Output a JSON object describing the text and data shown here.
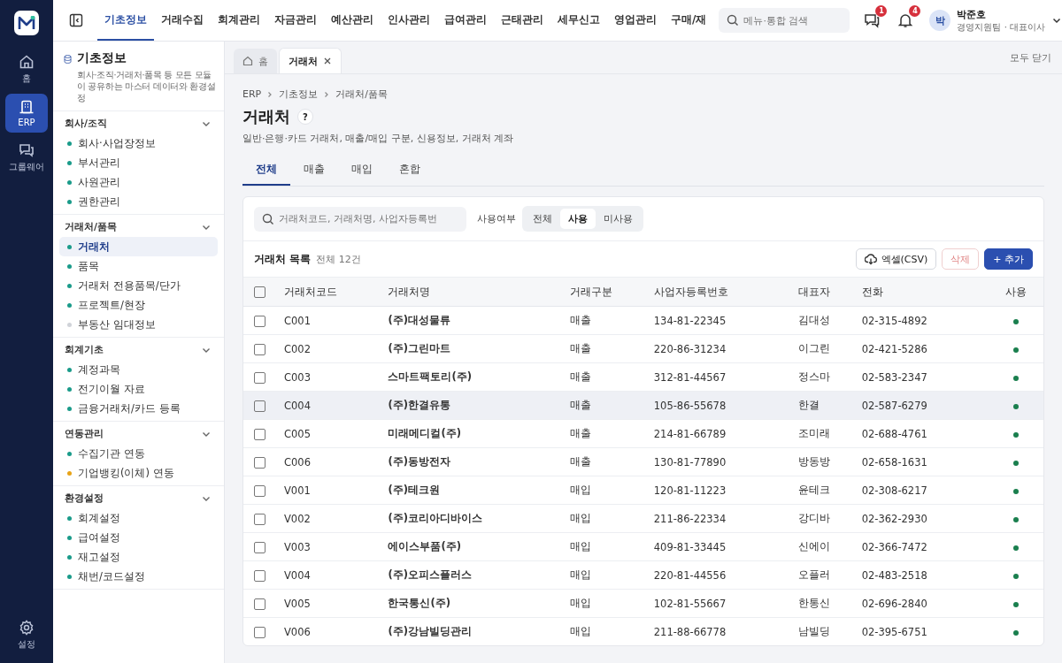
{
  "rail": {
    "items": [
      {
        "label": "홈",
        "selected": false
      },
      {
        "label": "ERP",
        "selected": true
      },
      {
        "label": "그룹웨어",
        "selected": false
      }
    ],
    "settings": "설정"
  },
  "top_nav": {
    "tabs": [
      {
        "label": "기초정보",
        "selected": true
      },
      {
        "label": "거래수집",
        "selected": false
      },
      {
        "label": "회계관리",
        "selected": false
      },
      {
        "label": "자금관리",
        "selected": false
      },
      {
        "label": "예산관리",
        "selected": false
      },
      {
        "label": "인사관리",
        "selected": false
      },
      {
        "label": "급여관리",
        "selected": false
      },
      {
        "label": "근태관리",
        "selected": false
      },
      {
        "label": "세무신고",
        "selected": false
      },
      {
        "label": "영업관리",
        "selected": false
      },
      {
        "label": "구매/재",
        "selected": false
      }
    ],
    "search": {
      "placeholder": "메뉴·통합 검색"
    },
    "messages_badge": "1",
    "alerts_badge": "4",
    "user": {
      "avatar": "박",
      "name": "박준호",
      "role": "경영지원팀 · 대표이사"
    }
  },
  "sidebar": {
    "title": "기초정보",
    "description": "회사·조직·거래처·품목 등 모든 모듈이 공유하는 마스터 데이터와 환경설정",
    "groups": [
      {
        "title": "회사/조직",
        "expanded": true,
        "items": [
          {
            "label": "회사·사업장정보",
            "color": "#1a9b8a",
            "selected": false
          },
          {
            "label": "부서관리",
            "color": "#1a9b8a",
            "selected": false
          },
          {
            "label": "사원관리",
            "color": "#1a9b8a",
            "selected": false
          },
          {
            "label": "권한관리",
            "color": "#1a9b8a",
            "selected": false
          }
        ]
      },
      {
        "title": "거래처/품목",
        "expanded": true,
        "items": [
          {
            "label": "거래처",
            "color": "#1a9b8a",
            "selected": true
          },
          {
            "label": "품목",
            "color": "#1a9b8a",
            "selected": false
          },
          {
            "label": "거래처 전용품목/단가",
            "color": "#1a9b8a",
            "selected": false
          },
          {
            "label": "프로젝트/현장",
            "color": "#1a9b8a",
            "selected": false
          },
          {
            "label": "부동산 임대정보",
            "color": "#d0d3d9",
            "selected": false
          }
        ]
      },
      {
        "title": "회계기초",
        "expanded": true,
        "items": [
          {
            "label": "계정과목",
            "color": "#1a9b8a",
            "selected": false
          },
          {
            "label": "전기이월 자료",
            "color": "#1a9b8a",
            "selected": false
          },
          {
            "label": "금융거래처/카드 등록",
            "color": "#1a9b8a",
            "selected": false
          }
        ]
      },
      {
        "title": "연동관리",
        "expanded": true,
        "items": [
          {
            "label": "수집기관 연동",
            "color": "#1a9b8a",
            "selected": false
          },
          {
            "label": "기업뱅킹(이체) 연동",
            "color": "#e8a317",
            "selected": false
          }
        ]
      },
      {
        "title": "환경설정",
        "expanded": true,
        "items": [
          {
            "label": "회계설정",
            "color": "#1a9b8a",
            "selected": false
          },
          {
            "label": "급여설정",
            "color": "#1a9b8a",
            "selected": false
          },
          {
            "label": "재고설정",
            "color": "#1a9b8a",
            "selected": false
          },
          {
            "label": "채번/코드설정",
            "color": "#1a9b8a",
            "selected": false
          }
        ]
      }
    ]
  },
  "page_tabs": {
    "tabs": [
      {
        "label": "홈",
        "kind": "home",
        "selected": false
      },
      {
        "label": "거래처",
        "kind": "closable",
        "selected": true
      }
    ],
    "close_all": "모두 닫기"
  },
  "breadcrumb": [
    "ERP",
    "기초정보",
    "거래처/품목"
  ],
  "page": {
    "title": "거래처",
    "help": "?",
    "subtitle": "일반·은행·카드 거래처, 매출/매입 구분, 신용정보, 거래처 계좌"
  },
  "filter_tabs": [
    {
      "label": "전체",
      "selected": true
    },
    {
      "label": "매출",
      "selected": false
    },
    {
      "label": "매입",
      "selected": false
    },
    {
      "label": "혼합",
      "selected": false
    }
  ],
  "filters": {
    "search_placeholder": "거래처코드, 거래처명, 사업자등록번",
    "usage_label": "사용여부",
    "usage_options": [
      {
        "label": "전체",
        "selected": false
      },
      {
        "label": "사용",
        "selected": true
      },
      {
        "label": "미사용",
        "selected": false
      }
    ]
  },
  "list": {
    "title": "거래처 목록",
    "count": "전체 12건",
    "buttons": {
      "export": "엑셀(CSV)",
      "delete": "삭제",
      "add": "+ 추가"
    },
    "columns": [
      "거래처코드",
      "거래처명",
      "거래구분",
      "사업자등록번호",
      "대표자",
      "전화",
      "사용"
    ],
    "header_checked": false,
    "rows": [
      {
        "code": "C001",
        "name": "(주)대성물류",
        "type": "매출",
        "biz_no": "134-81-22345",
        "ceo": "김대성",
        "phone": "02-315-4892",
        "active": true,
        "checked": false,
        "selected": false
      },
      {
        "code": "C002",
        "name": "(주)그린마트",
        "type": "매출",
        "biz_no": "220-86-31234",
        "ceo": "이그린",
        "phone": "02-421-5286",
        "active": true,
        "checked": false,
        "selected": false
      },
      {
        "code": "C003",
        "name": "스마트팩토리(주)",
        "type": "매출",
        "biz_no": "312-81-44567",
        "ceo": "정스마",
        "phone": "02-583-2347",
        "active": true,
        "checked": false,
        "selected": false
      },
      {
        "code": "C004",
        "name": "(주)한결유통",
        "type": "매출",
        "biz_no": "105-86-55678",
        "ceo": "한결",
        "phone": "02-587-6279",
        "active": true,
        "checked": false,
        "selected": true
      },
      {
        "code": "C005",
        "name": "미래메디컬(주)",
        "type": "매출",
        "biz_no": "214-81-66789",
        "ceo": "조미래",
        "phone": "02-688-4761",
        "active": true,
        "checked": false,
        "selected": false
      },
      {
        "code": "C006",
        "name": "(주)동방전자",
        "type": "매출",
        "biz_no": "130-81-77890",
        "ceo": "방동방",
        "phone": "02-658-1631",
        "active": true,
        "checked": false,
        "selected": false
      },
      {
        "code": "V001",
        "name": "(주)테크원",
        "type": "매입",
        "biz_no": "120-81-11223",
        "ceo": "윤테크",
        "phone": "02-308-6217",
        "active": true,
        "checked": false,
        "selected": false
      },
      {
        "code": "V002",
        "name": "(주)코리아디바이스",
        "type": "매입",
        "biz_no": "211-86-22334",
        "ceo": "강디바",
        "phone": "02-362-2930",
        "active": true,
        "checked": false,
        "selected": false
      },
      {
        "code": "V003",
        "name": "에이스부품(주)",
        "type": "매입",
        "biz_no": "409-81-33445",
        "ceo": "신에이",
        "phone": "02-366-7472",
        "active": true,
        "checked": false,
        "selected": false
      },
      {
        "code": "V004",
        "name": "(주)오피스플러스",
        "type": "매입",
        "biz_no": "220-81-44556",
        "ceo": "오플러",
        "phone": "02-483-2518",
        "active": true,
        "checked": false,
        "selected": false
      },
      {
        "code": "V005",
        "name": "한국통신(주)",
        "type": "매입",
        "biz_no": "102-81-55667",
        "ceo": "한통신",
        "phone": "02-696-2840",
        "active": true,
        "checked": false,
        "selected": false
      },
      {
        "code": "V006",
        "name": "(주)강남빌딩관리",
        "type": "매입",
        "biz_no": "211-88-66778",
        "ceo": "남빌딩",
        "phone": "02-395-6751",
        "active": true,
        "checked": false,
        "selected": false
      }
    ]
  }
}
